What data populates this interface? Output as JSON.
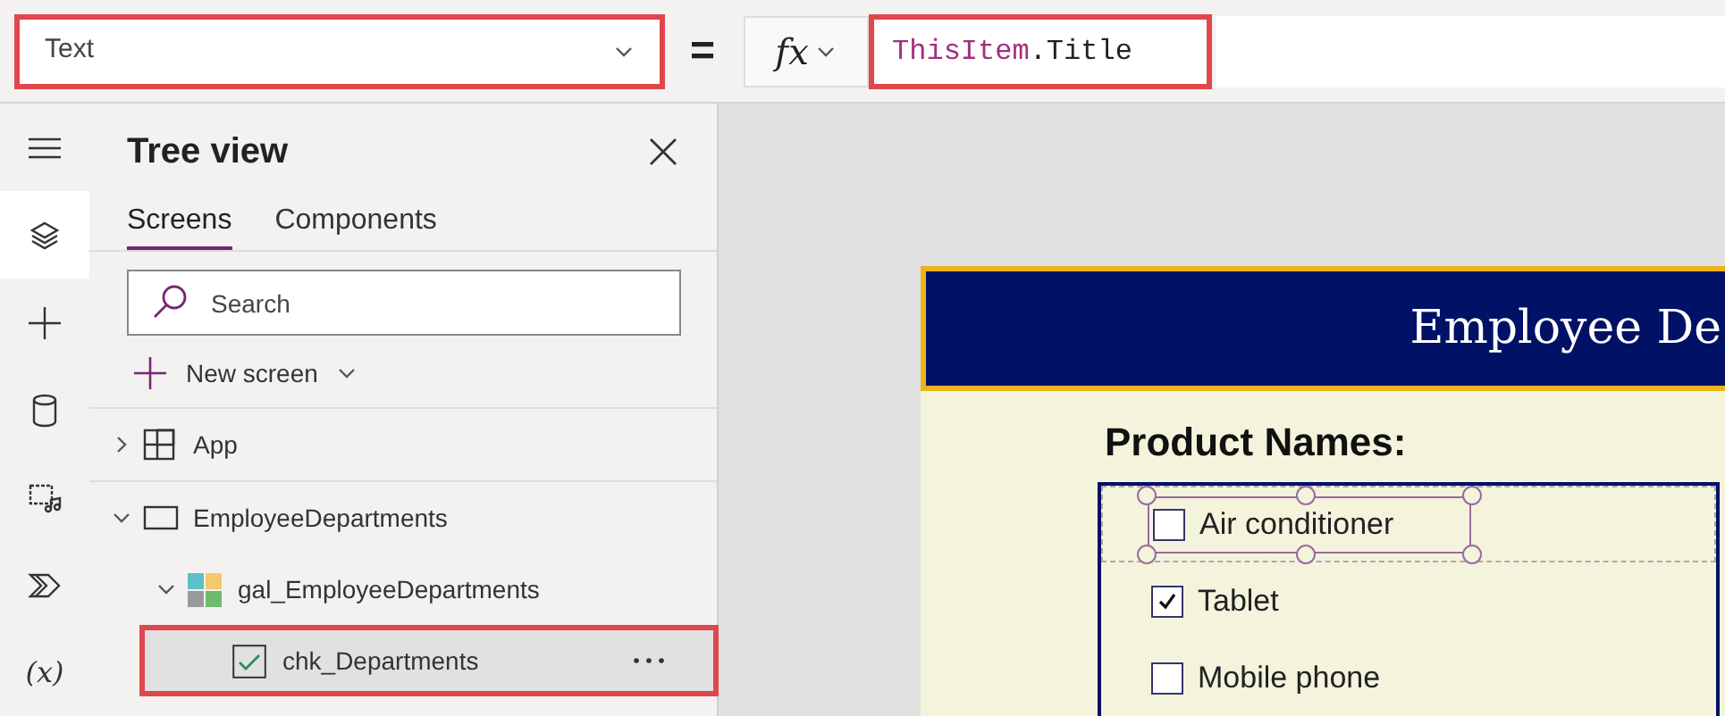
{
  "property_selector": {
    "value": "Text",
    "highlighted": true
  },
  "equals": "=",
  "fx": {
    "label": "fx"
  },
  "formula": {
    "highlighted": true,
    "segments": [
      {
        "text": "ThisItem",
        "kind": "keyword"
      },
      {
        "text": ".Title",
        "kind": "plain"
      }
    ]
  },
  "rail": [
    {
      "kind": "menu",
      "selected": false
    },
    {
      "kind": "layers",
      "selected": true
    },
    {
      "kind": "plus",
      "selected": false
    },
    {
      "kind": "data",
      "selected": false
    },
    {
      "kind": "media",
      "selected": false
    },
    {
      "kind": "components",
      "selected": false
    },
    {
      "kind": "variables",
      "text": "(x)",
      "selected": false
    }
  ],
  "tree_view": {
    "title": "Tree view",
    "tabs": [
      {
        "label": "Screens",
        "selected": true
      },
      {
        "label": "Components",
        "selected": false
      }
    ],
    "search": {
      "placeholder": "Search"
    },
    "new_screen": "New screen",
    "nodes": [
      {
        "label": "App",
        "kind": "app",
        "expanded": false
      },
      {
        "label": "EmployeeDepartments",
        "kind": "screen",
        "expanded": true,
        "children": [
          {
            "label": "gal_EmployeeDepartments",
            "kind": "gallery",
            "expanded": true,
            "children": [
              {
                "label": "chk_Departments",
                "kind": "checkbox",
                "selected": true,
                "highlighted": true
              }
            ]
          }
        ]
      }
    ]
  },
  "app_screen": {
    "title": "Employee De",
    "label": "Product Names:",
    "items": [
      {
        "label": "Air conditioner",
        "checked": false,
        "selected": true
      },
      {
        "label": "Tablet",
        "checked": true,
        "selected": false
      },
      {
        "label": "Mobile phone",
        "checked": false,
        "selected": false
      }
    ]
  }
}
